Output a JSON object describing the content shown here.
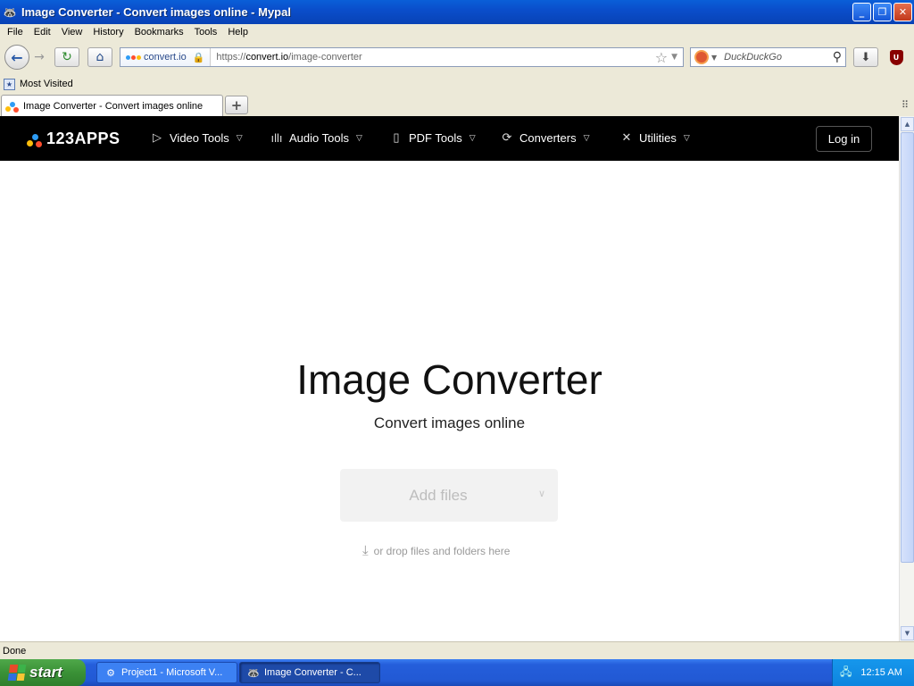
{
  "window": {
    "title": "Image Converter - Convert images online - Mypal",
    "buttons": {
      "minimize": "_",
      "maximize": "❐",
      "close": "✕"
    }
  },
  "menu": [
    "File",
    "Edit",
    "View",
    "History",
    "Bookmarks",
    "Tools",
    "Help"
  ],
  "toolbar": {
    "identity_label": "convert.io",
    "url_scheme": "https://",
    "url_host": "convert.io",
    "url_path": "/image-converter",
    "search_placeholder": "DuckDuckGo"
  },
  "bookmarks": {
    "most_visited": "Most Visited"
  },
  "tab": {
    "title": "Image Converter - Convert images online",
    "new_tab": "+"
  },
  "site": {
    "brand": "123APPS",
    "nav": [
      {
        "label": "Video Tools",
        "icon": "play-icon"
      },
      {
        "label": "Audio Tools",
        "icon": "waveform-icon"
      },
      {
        "label": "PDF Tools",
        "icon": "document-icon"
      },
      {
        "label": "Converters",
        "icon": "refresh-icon"
      },
      {
        "label": "Utilities",
        "icon": "tools-icon"
      }
    ],
    "login": "Log in",
    "brand_colors": [
      "#2d9cf5",
      "#ff4d2d",
      "#ffbe0b"
    ]
  },
  "main": {
    "title": "Image Converter",
    "subtitle": "Convert images online",
    "add_files": "Add files",
    "drop_hint": "or drop files and folders here"
  },
  "status": {
    "text": "Done"
  },
  "taskbar": {
    "start": "start",
    "tasks": [
      "Project1 - Microsoft V...",
      "Image Converter - C..."
    ],
    "clock": "12:15 AM"
  }
}
